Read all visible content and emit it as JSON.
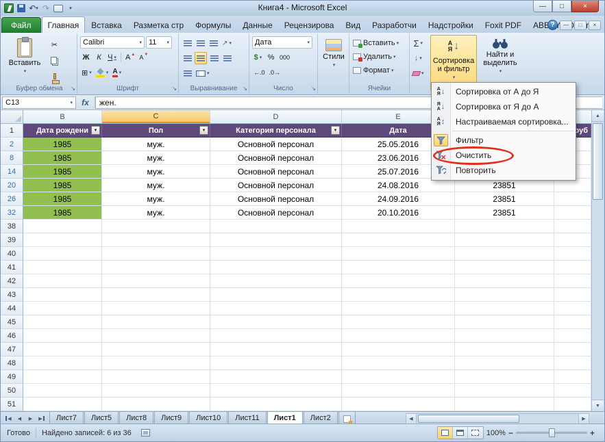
{
  "titlebar": {
    "title": "Книга4 - Microsoft Excel"
  },
  "ribbon_tabs": {
    "file": "Файл",
    "home": "Главная",
    "insert": "Вставка",
    "page_layout": "Разметка стр",
    "formulas": "Формулы",
    "data": "Данные",
    "review": "Рецензирова",
    "view": "Вид",
    "developer": "Разработчи",
    "addins": "Надстройки",
    "foxit": "Foxit PDF",
    "abbyy": "ABBYY PDF Tr"
  },
  "ribbon": {
    "clipboard": {
      "label": "Буфер обмена",
      "paste": "Вставить"
    },
    "font": {
      "label": "Шрифт",
      "family": "Calibri",
      "size": "11",
      "bold": "Ж",
      "italic": "К",
      "underline": "Ч",
      "letter": "А"
    },
    "alignment": {
      "label": "Выравнивание"
    },
    "number": {
      "label": "Число",
      "format": "Дата",
      "currency": "$",
      "percent": "%",
      "thousands": "000",
      "inc_decimal": "←.0",
      "dec_decimal": ".0→"
    },
    "styles": {
      "button": "Стили"
    },
    "cells": {
      "label": "Ячейки",
      "insert": "Вставить",
      "delete": "Удалить",
      "format": "Формат"
    },
    "editing": {
      "sort_filter": "Сортировка и фильтр",
      "find": "Найти и выделить"
    }
  },
  "formula_bar": {
    "name_box": "C13",
    "fx": "fx",
    "value": "жен."
  },
  "columns": {
    "b": "B",
    "c": "C",
    "d": "D",
    "e": "E"
  },
  "grid": {
    "header": {
      "num": "1",
      "birth_date": "Дата рождени",
      "gender": "Пол",
      "category": "Категория персонала",
      "date": "Дата",
      "partial_right": "руб"
    },
    "rows": [
      {
        "num": "2",
        "b": "1985",
        "c": "муж.",
        "d": "Основной персонал",
        "e": "25.05.2016",
        "f": ""
      },
      {
        "num": "8",
        "b": "1985",
        "c": "муж.",
        "d": "Основной персонал",
        "e": "23.06.2016",
        "f": ""
      },
      {
        "num": "14",
        "b": "1985",
        "c": "муж.",
        "d": "Основной персонал",
        "e": "25.07.2016",
        "f": ""
      },
      {
        "num": "20",
        "b": "1985",
        "c": "муж.",
        "d": "Основной персонал",
        "e": "24.08.2016",
        "f": "23851"
      },
      {
        "num": "26",
        "b": "1985",
        "c": "муж.",
        "d": "Основной персонал",
        "e": "24.09.2016",
        "f": "23851"
      },
      {
        "num": "32",
        "b": "1985",
        "c": "муж.",
        "d": "Основной персонал",
        "e": "20.10.2016",
        "f": "23851"
      }
    ],
    "empty_rows": [
      "38",
      "39",
      "40",
      "41",
      "42",
      "43",
      "44",
      "45",
      "46",
      "47",
      "48",
      "49",
      "50",
      "51"
    ]
  },
  "menu": {
    "sort_az": "Сортировка от А до Я",
    "sort_za": "Сортировка от Я до А",
    "custom_sort": "Настраиваемая сортировка...",
    "filter": "Фильтр",
    "clear": "Очистить",
    "reapply": "Повторить"
  },
  "sheet_tabs": [
    "Лист7",
    "Лист5",
    "Лист8",
    "Лист9",
    "Лист10",
    "Лист11",
    "Лист1",
    "Лист2"
  ],
  "status_bar": {
    "ready": "Готово",
    "records": "Найдено записей: 6 из 36",
    "zoom": "100%"
  },
  "icons": {
    "dropdown": "▾",
    "up": "▲",
    "down": "▼",
    "left": "◀",
    "right": "▶",
    "undo": "↶",
    "redo": "↷",
    "minimize": "—",
    "maximize": "□",
    "close": "×",
    "help": "?",
    "cut": "✂",
    "borders": "⊞",
    "sum": "Σ",
    "sort_a": "А",
    "sort_ya": "Я",
    "arrow_down": "↓",
    "arrow_updown": "↕",
    "orientation": "↗",
    "launcher": "↘",
    "minus": "−",
    "plus": "+"
  },
  "colors": {
    "header_purple": "#5F497B",
    "cell_green": "#92C050",
    "annotation_red": "#E0301E",
    "file_tab_green": "#2E7D36",
    "filtered_row_blue": "#2A6DB5",
    "selected_column_header": "#F8C768"
  }
}
